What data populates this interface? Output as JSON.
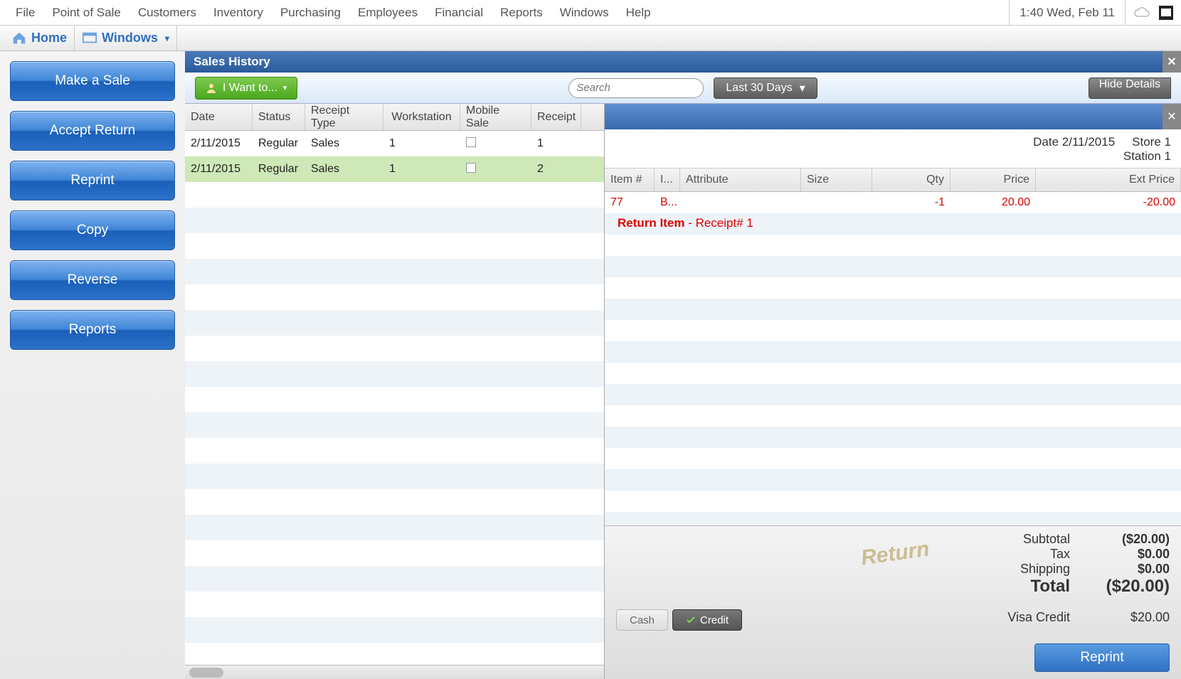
{
  "menubar": {
    "items": [
      "File",
      "Point of Sale",
      "Customers",
      "Inventory",
      "Purchasing",
      "Employees",
      "Financial",
      "Reports",
      "Windows",
      "Help"
    ],
    "clock": "1:40 Wed, Feb 11"
  },
  "ribbon": {
    "home": "Home",
    "windows": "Windows"
  },
  "sidebar": {
    "buttons": [
      "Make a Sale",
      "Accept Return",
      "Reprint",
      "Copy",
      "Reverse",
      "Reports"
    ]
  },
  "page": {
    "title": "Sales History",
    "iwant": "I Want to...",
    "search_placeholder": "Search",
    "date_range": "Last 30 Days",
    "hide_details": "Hide Details"
  },
  "grid": {
    "columns": [
      "Date",
      "Status",
      "Receipt Type",
      "Workstation",
      "Mobile Sale",
      "Receipt"
    ],
    "rows": [
      {
        "date": "2/11/2015",
        "status": "Regular",
        "rtype": "Sales",
        "ws": "1",
        "mobile": false,
        "receipt": "1",
        "selected": false
      },
      {
        "date": "2/11/2015",
        "status": "Regular",
        "rtype": "Sales",
        "ws": "1",
        "mobile": false,
        "receipt": "2",
        "selected": true
      }
    ]
  },
  "detail": {
    "date_label": "Date",
    "date": "2/11/2015",
    "store_label": "Store",
    "store": "1",
    "station_label": "Station",
    "station": "1",
    "item_columns": [
      "Item #",
      "I...",
      "Attribute",
      "Size",
      "Qty",
      "Price",
      "Ext Price"
    ],
    "items": [
      {
        "item_no": "77",
        "i": "B...",
        "attribute": "",
        "size": "",
        "qty": "-1",
        "price": "20.00",
        "ext": "-20.00"
      }
    ],
    "return_item_label": "Return Item",
    "return_item_sub": " - Receipt# 1",
    "return_stamp": "Return",
    "totals": {
      "subtotal_label": "Subtotal",
      "subtotal": "($20.00)",
      "tax_label": "Tax",
      "tax": "$0.00",
      "shipping_label": "Shipping",
      "shipping": "$0.00",
      "total_label": "Total",
      "total": "($20.00)"
    },
    "tender": {
      "label": "Visa  Credit",
      "amount": "$20.00"
    },
    "cash_btn": "Cash",
    "credit_btn": "Credit",
    "reprint": "Reprint"
  }
}
